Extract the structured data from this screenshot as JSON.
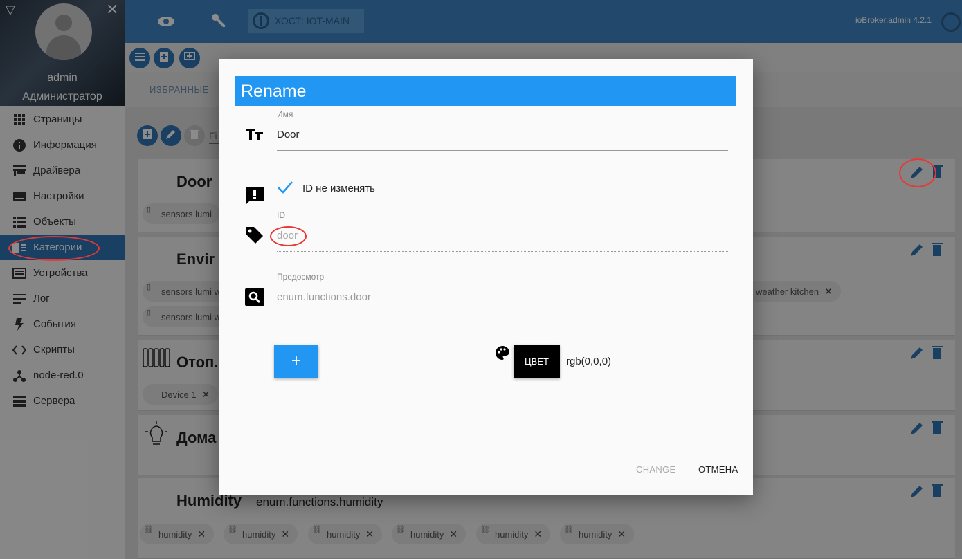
{
  "profile": {
    "username": "admin",
    "role": "Администратор"
  },
  "sidebar": {
    "items": [
      {
        "label": "Страницы",
        "icon": "apps-icon"
      },
      {
        "label": "Информация",
        "icon": "info-icon"
      },
      {
        "label": "Драйвера",
        "icon": "store-icon"
      },
      {
        "label": "Настройки",
        "icon": "settings-icon"
      },
      {
        "label": "Объекты",
        "icon": "list-icon"
      },
      {
        "label": "Категории",
        "icon": "category-icon",
        "active": true
      },
      {
        "label": "Устройства",
        "icon": "devices-icon"
      },
      {
        "label": "Лог",
        "icon": "log-icon"
      },
      {
        "label": "События",
        "icon": "flash-icon"
      },
      {
        "label": "Скрипты",
        "icon": "code-icon"
      },
      {
        "label": "node-red.0",
        "icon": "node-red-icon"
      },
      {
        "label": "Сервера",
        "icon": "servers-icon"
      }
    ]
  },
  "topbar": {
    "host": "ХОСТ: IOT-MAIN",
    "version": "ioBroker.admin 4.2.1"
  },
  "tabs": {
    "favorites": "ИЗБРАННЫЕ"
  },
  "filter": {
    "placeholder": "Fi"
  },
  "main": {
    "card_door": {
      "title": "Door",
      "chip1": "sensors lumi"
    },
    "card_env": {
      "title": "Envir",
      "chip1": "sensors lumi w",
      "chip2": "sensors lumi w",
      "chip3": "weather kitchen"
    },
    "card_heat": {
      "title": "Отоп.",
      "chip1": "Device 1"
    },
    "card_home": {
      "title": "Дома"
    },
    "card_hum": {
      "title": "Humidity",
      "subtitle": "enum.functions.humidity",
      "chips": [
        "humidity",
        "humidity",
        "humidity",
        "humidity",
        "humidity",
        "humidity"
      ]
    }
  },
  "dialog": {
    "title": "Rename",
    "name_label": "Имя",
    "name_value": "Door",
    "keep_id_label": "ID не изменять",
    "id_label": "ID",
    "id_value": "door",
    "preview_label": "Предосмотр",
    "preview_value": "enum.functions.door",
    "plus_label": "+",
    "color_button": "ЦВЕТ",
    "color_value": "rgb(0,0,0)",
    "change_button": "CHANGE",
    "cancel_button": "ОТМЕНА"
  },
  "colors": {
    "accent": "#2196f3",
    "topbar": "#3f86c4",
    "active_nav": "#2f74b5",
    "annotation": "#e53935"
  }
}
